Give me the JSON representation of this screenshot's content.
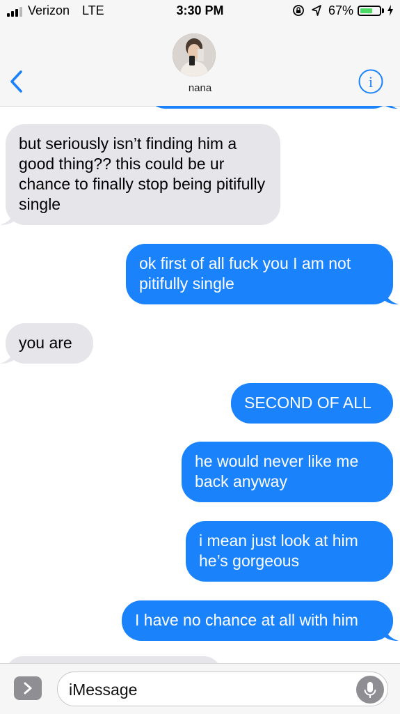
{
  "status_bar": {
    "carrier": "Verizon",
    "network": "LTE",
    "time": "3:30 PM",
    "battery_percent": "67%",
    "battery_level": 0.67,
    "battery_color": "#4cd964",
    "icons": [
      "signal-bars",
      "orientation-lock-icon",
      "location-arrow-icon",
      "battery-icon",
      "charging-bolt-icon"
    ]
  },
  "header": {
    "contact_name": "nana",
    "back_icon": "chevron-left-icon",
    "info_icon": "info-icon",
    "accent_color": "#1a82fb"
  },
  "messages": [
    {
      "direction": "received",
      "text": "but seriously isn’t finding him a good thing?? this could be ur chance to finally stop being pitifully single"
    },
    {
      "direction": "sent",
      "text": "ok first of all fuck you I am not pitifully single"
    },
    {
      "direction": "received",
      "text": "you are"
    },
    {
      "direction": "sent",
      "text": "SECOND OF ALL"
    },
    {
      "direction": "sent",
      "text": "he would never like me back anyway"
    },
    {
      "direction": "sent",
      "text": "i mean just look at him he’s gorgeous"
    },
    {
      "direction": "sent",
      "text": "I have no chance at all with him"
    }
  ],
  "colors": {
    "sent_bubble": "#1a82fb",
    "received_bubble": "#e5e5ea"
  },
  "input_bar": {
    "placeholder": "iMessage",
    "apps_icon": "chevron-right-icon",
    "mic_icon": "microphone-icon"
  }
}
